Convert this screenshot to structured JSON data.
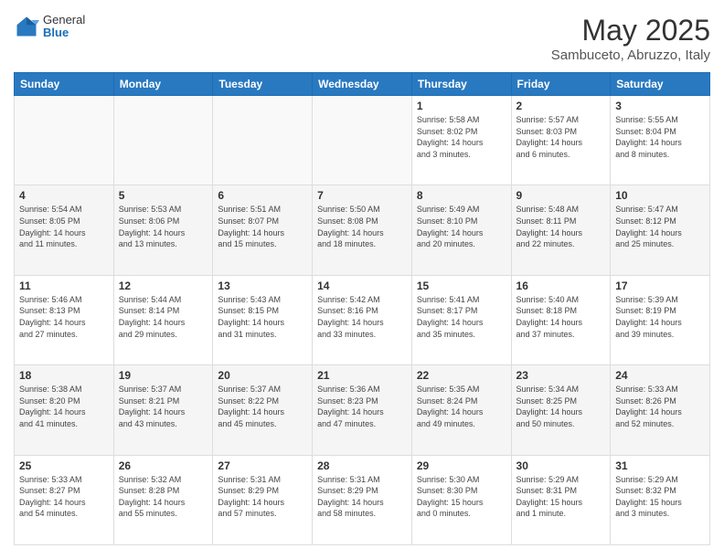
{
  "logo": {
    "general": "General",
    "blue": "Blue"
  },
  "title": "May 2025",
  "subtitle": "Sambuceto, Abruzzo, Italy",
  "headers": [
    "Sunday",
    "Monday",
    "Tuesday",
    "Wednesday",
    "Thursday",
    "Friday",
    "Saturday"
  ],
  "weeks": [
    [
      {
        "day": "",
        "info": ""
      },
      {
        "day": "",
        "info": ""
      },
      {
        "day": "",
        "info": ""
      },
      {
        "day": "",
        "info": ""
      },
      {
        "day": "1",
        "info": "Sunrise: 5:58 AM\nSunset: 8:02 PM\nDaylight: 14 hours\nand 3 minutes."
      },
      {
        "day": "2",
        "info": "Sunrise: 5:57 AM\nSunset: 8:03 PM\nDaylight: 14 hours\nand 6 minutes."
      },
      {
        "day": "3",
        "info": "Sunrise: 5:55 AM\nSunset: 8:04 PM\nDaylight: 14 hours\nand 8 minutes."
      }
    ],
    [
      {
        "day": "4",
        "info": "Sunrise: 5:54 AM\nSunset: 8:05 PM\nDaylight: 14 hours\nand 11 minutes."
      },
      {
        "day": "5",
        "info": "Sunrise: 5:53 AM\nSunset: 8:06 PM\nDaylight: 14 hours\nand 13 minutes."
      },
      {
        "day": "6",
        "info": "Sunrise: 5:51 AM\nSunset: 8:07 PM\nDaylight: 14 hours\nand 15 minutes."
      },
      {
        "day": "7",
        "info": "Sunrise: 5:50 AM\nSunset: 8:08 PM\nDaylight: 14 hours\nand 18 minutes."
      },
      {
        "day": "8",
        "info": "Sunrise: 5:49 AM\nSunset: 8:10 PM\nDaylight: 14 hours\nand 20 minutes."
      },
      {
        "day": "9",
        "info": "Sunrise: 5:48 AM\nSunset: 8:11 PM\nDaylight: 14 hours\nand 22 minutes."
      },
      {
        "day": "10",
        "info": "Sunrise: 5:47 AM\nSunset: 8:12 PM\nDaylight: 14 hours\nand 25 minutes."
      }
    ],
    [
      {
        "day": "11",
        "info": "Sunrise: 5:46 AM\nSunset: 8:13 PM\nDaylight: 14 hours\nand 27 minutes."
      },
      {
        "day": "12",
        "info": "Sunrise: 5:44 AM\nSunset: 8:14 PM\nDaylight: 14 hours\nand 29 minutes."
      },
      {
        "day": "13",
        "info": "Sunrise: 5:43 AM\nSunset: 8:15 PM\nDaylight: 14 hours\nand 31 minutes."
      },
      {
        "day": "14",
        "info": "Sunrise: 5:42 AM\nSunset: 8:16 PM\nDaylight: 14 hours\nand 33 minutes."
      },
      {
        "day": "15",
        "info": "Sunrise: 5:41 AM\nSunset: 8:17 PM\nDaylight: 14 hours\nand 35 minutes."
      },
      {
        "day": "16",
        "info": "Sunrise: 5:40 AM\nSunset: 8:18 PM\nDaylight: 14 hours\nand 37 minutes."
      },
      {
        "day": "17",
        "info": "Sunrise: 5:39 AM\nSunset: 8:19 PM\nDaylight: 14 hours\nand 39 minutes."
      }
    ],
    [
      {
        "day": "18",
        "info": "Sunrise: 5:38 AM\nSunset: 8:20 PM\nDaylight: 14 hours\nand 41 minutes."
      },
      {
        "day": "19",
        "info": "Sunrise: 5:37 AM\nSunset: 8:21 PM\nDaylight: 14 hours\nand 43 minutes."
      },
      {
        "day": "20",
        "info": "Sunrise: 5:37 AM\nSunset: 8:22 PM\nDaylight: 14 hours\nand 45 minutes."
      },
      {
        "day": "21",
        "info": "Sunrise: 5:36 AM\nSunset: 8:23 PM\nDaylight: 14 hours\nand 47 minutes."
      },
      {
        "day": "22",
        "info": "Sunrise: 5:35 AM\nSunset: 8:24 PM\nDaylight: 14 hours\nand 49 minutes."
      },
      {
        "day": "23",
        "info": "Sunrise: 5:34 AM\nSunset: 8:25 PM\nDaylight: 14 hours\nand 50 minutes."
      },
      {
        "day": "24",
        "info": "Sunrise: 5:33 AM\nSunset: 8:26 PM\nDaylight: 14 hours\nand 52 minutes."
      }
    ],
    [
      {
        "day": "25",
        "info": "Sunrise: 5:33 AM\nSunset: 8:27 PM\nDaylight: 14 hours\nand 54 minutes."
      },
      {
        "day": "26",
        "info": "Sunrise: 5:32 AM\nSunset: 8:28 PM\nDaylight: 14 hours\nand 55 minutes."
      },
      {
        "day": "27",
        "info": "Sunrise: 5:31 AM\nSunset: 8:29 PM\nDaylight: 14 hours\nand 57 minutes."
      },
      {
        "day": "28",
        "info": "Sunrise: 5:31 AM\nSunset: 8:29 PM\nDaylight: 14 hours\nand 58 minutes."
      },
      {
        "day": "29",
        "info": "Sunrise: 5:30 AM\nSunset: 8:30 PM\nDaylight: 15 hours\nand 0 minutes."
      },
      {
        "day": "30",
        "info": "Sunrise: 5:29 AM\nSunset: 8:31 PM\nDaylight: 15 hours\nand 1 minute."
      },
      {
        "day": "31",
        "info": "Sunrise: 5:29 AM\nSunset: 8:32 PM\nDaylight: 15 hours\nand 3 minutes."
      }
    ]
  ]
}
